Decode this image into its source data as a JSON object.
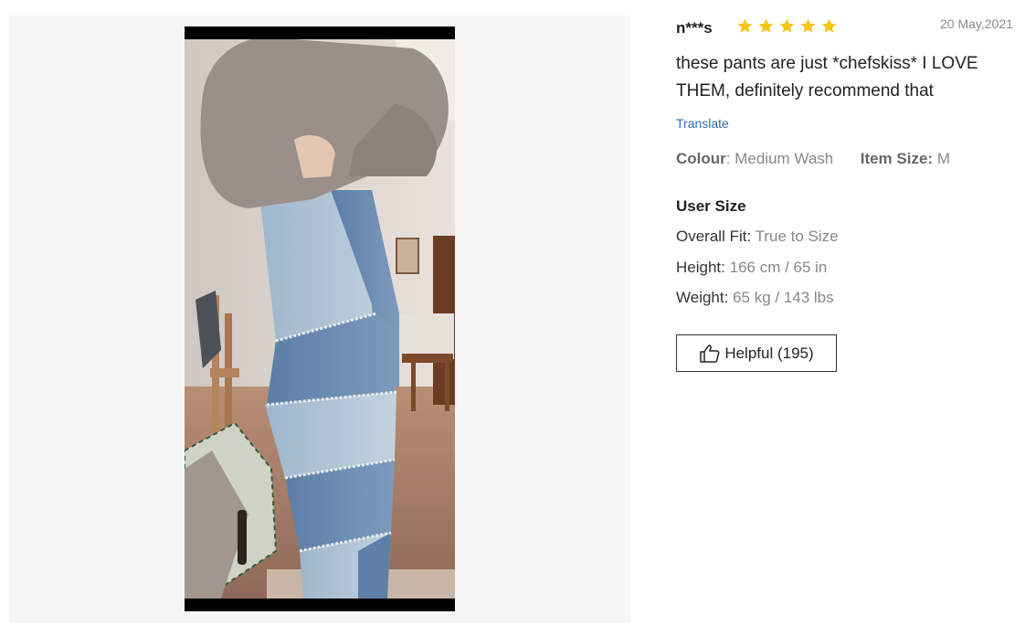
{
  "review": {
    "reviewer": "n***s",
    "rating": 5,
    "date": "20 May,2021",
    "text": "these pants are just *chefskiss* I LOVE THEM, definitely recommend that",
    "translate_label": "Translate",
    "colour_label": "Colour",
    "colour_value": "Medium Wash",
    "item_size_label": "Item Size:",
    "item_size_value": "M",
    "user_size_heading": "User Size",
    "overall_fit_label": "Overall Fit:",
    "overall_fit_value": "True to Size",
    "height_label": "Height:",
    "height_value": "166 cm / 65 in",
    "weight_label": "Weight:",
    "weight_value": "65 kg / 143 lbs",
    "helpful_label": "Helpful (195)"
  },
  "icons": {
    "star": "star-icon",
    "thumbs_up": "thumbs-up-icon",
    "video": "review-video"
  },
  "colors": {
    "star": "#f5c518",
    "link": "#2b6cb0",
    "panel_bg": "#f6f6f6"
  }
}
